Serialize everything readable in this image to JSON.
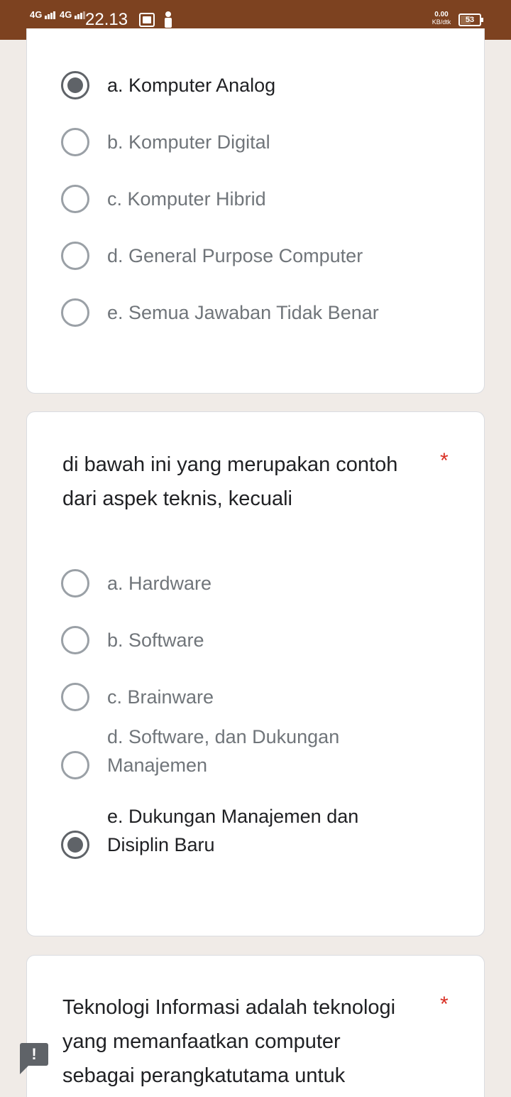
{
  "status_bar": {
    "network1": "4G",
    "network2": "4G",
    "time": "22.13",
    "speed_value": "0.00",
    "speed_unit": "KB/dtk",
    "battery_level": "53"
  },
  "questions": [
    {
      "options": [
        {
          "label": "a. Komputer Analog",
          "checked": true
        },
        {
          "label": "b. Komputer Digital",
          "checked": false
        },
        {
          "label": "c. Komputer Hibrid",
          "checked": false
        },
        {
          "label": "d. General Purpose Computer",
          "checked": false
        },
        {
          "label": "e. Semua Jawaban Tidak Benar",
          "checked": false
        }
      ]
    },
    {
      "text_line1": "di bawah ini yang merupakan contoh",
      "text_line2": "dari aspek teknis, kecuali",
      "required_mark": "*",
      "options": [
        {
          "label": "a. Hardware",
          "checked": false
        },
        {
          "label": "b. Software",
          "checked": false
        },
        {
          "label": "c. Brainware",
          "checked": false
        },
        {
          "label_line1": "d. Software, dan Dukungan",
          "label_line2": "Manajemen",
          "checked": false
        },
        {
          "label_line1": "e. Dukungan Manajemen dan",
          "label_line2": "Disiplin Baru",
          "checked": true
        }
      ]
    },
    {
      "text_line1": "Teknologi Informasi adalah teknologi",
      "text_line2": "yang memanfaatkan computer",
      "text_line3": "sebagai perangkatutama untuk",
      "required_mark": "*"
    }
  ],
  "alert_badge": "!",
  "colors": {
    "status_bar": "#7d4220",
    "background": "#f0ebe7",
    "required": "#d93025",
    "radio_checked": "#5f6368"
  }
}
